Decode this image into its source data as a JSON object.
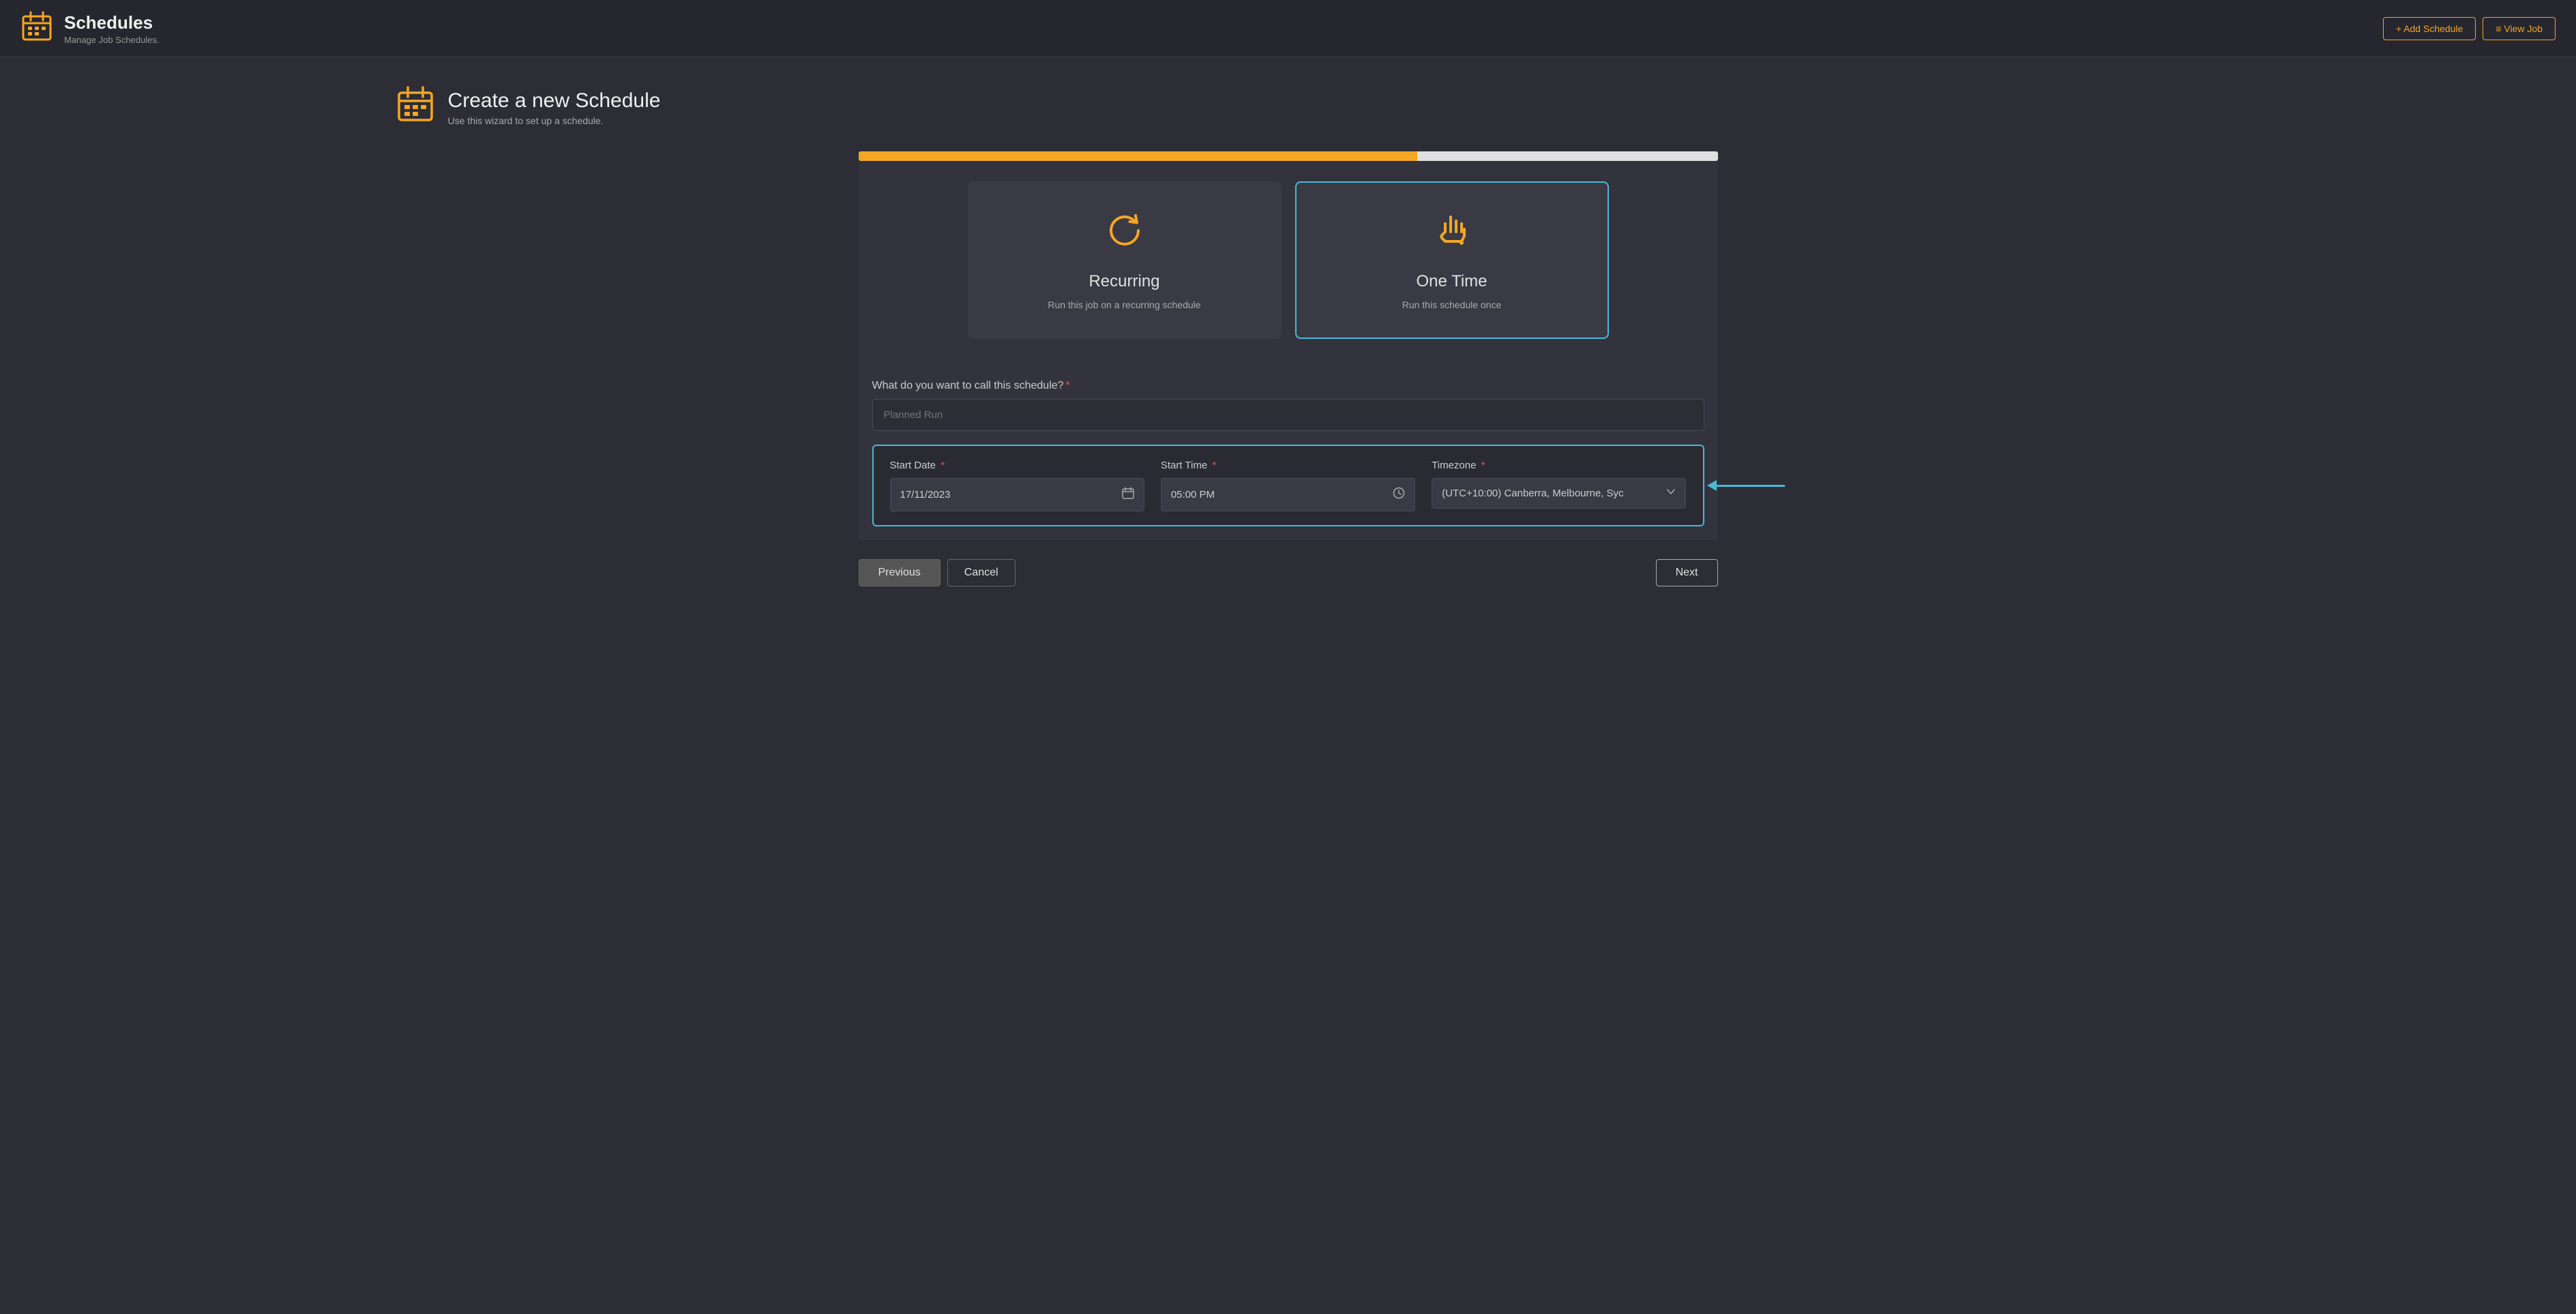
{
  "header": {
    "title": "Schedules",
    "subtitle": "Manage Job Schedules.",
    "add_schedule_label": "+ Add Schedule",
    "view_job_label": "≡ View Job"
  },
  "wizard": {
    "title": "Create a new Schedule",
    "subtitle": "Use this wizard to set up a schedule.",
    "progress_percent": 65
  },
  "schedule_types": [
    {
      "id": "recurring",
      "title": "Recurring",
      "description": "Run this job on a recurring schedule",
      "selected": false
    },
    {
      "id": "one_time",
      "title": "One Time",
      "description": "Run this schedule once",
      "selected": true
    }
  ],
  "form": {
    "schedule_name_label": "What do you want to call this schedule?",
    "schedule_name_placeholder": "Planned Run",
    "start_date_label": "Start Date",
    "start_date_value": "17/11/2023",
    "start_time_label": "Start Time",
    "start_time_value": "05:00 PM",
    "timezone_label": "Timezone",
    "timezone_value": "(UTC+10:00) Canberra, Melbourne, Syc"
  },
  "buttons": {
    "previous_label": "Previous",
    "cancel_label": "Cancel",
    "next_label": "Next"
  }
}
